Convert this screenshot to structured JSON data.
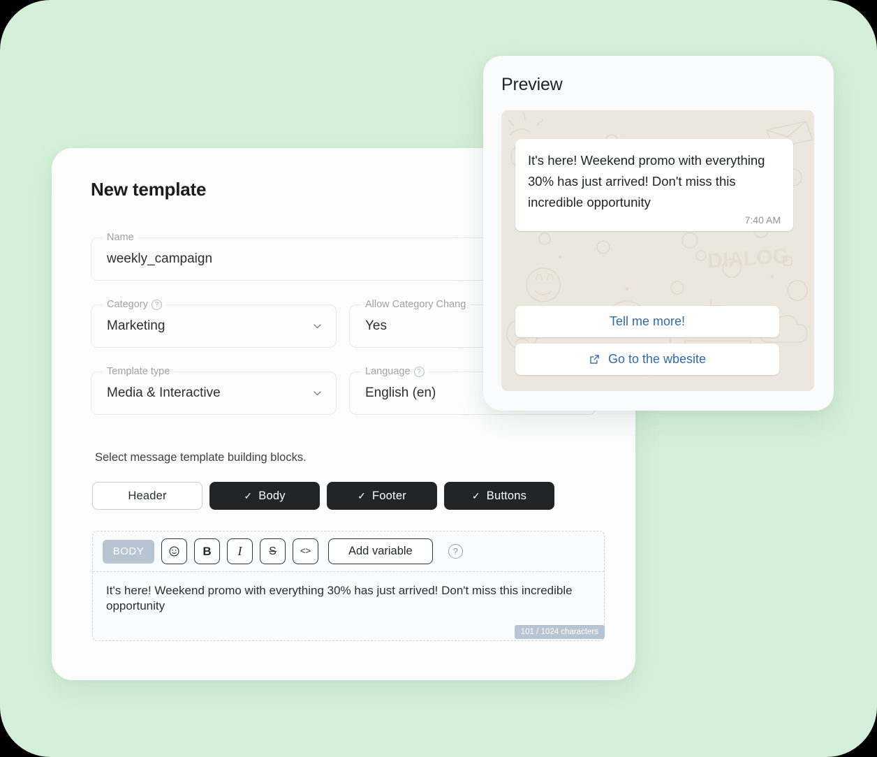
{
  "theme": {
    "background": "#d4f0d8",
    "card": "#fdfdfd",
    "accent_blue": "#2f6ab0",
    "dark_button": "#222426",
    "badge_gray": "#b9c4d2",
    "chat_background": "#ece7de"
  },
  "form": {
    "title": "New template",
    "fields": [
      {
        "label": "Name",
        "value": "weekly_campaign",
        "has_help": false,
        "has_chevron": false
      },
      {
        "label": "Category",
        "value": "Marketing",
        "has_help": true,
        "has_chevron": true
      },
      {
        "label": "Allow Category Chang",
        "value": "Yes",
        "has_help": false,
        "has_chevron": false
      },
      {
        "label": "Template type",
        "value": "Media & Interactive",
        "has_help": false,
        "has_chevron": true
      },
      {
        "label": "Language",
        "value": "English (en)",
        "has_help": true,
        "has_chevron": false
      }
    ]
  },
  "blocks": {
    "caption": "Select message template building blocks.",
    "items": [
      {
        "label": "Header",
        "selected": false,
        "check": ""
      },
      {
        "label": "Body",
        "selected": true,
        "check": "✓"
      },
      {
        "label": "Footer",
        "selected": true,
        "check": "✓"
      },
      {
        "label": "Buttons",
        "selected": true,
        "check": "✓"
      }
    ]
  },
  "editor": {
    "badge": "BODY",
    "tools": [
      {
        "name": "emoji-icon",
        "glyph": "☺"
      },
      {
        "name": "bold-icon",
        "glyph": "B"
      },
      {
        "name": "italic-icon",
        "glyph": "I"
      },
      {
        "name": "strikethrough-icon",
        "glyph": "S"
      },
      {
        "name": "code-icon",
        "glyph": "<>"
      }
    ],
    "add_variable_label": "Add variable",
    "help_glyph": "?",
    "body_text": "It's here! Weekend promo with everything 30% has just arrived! Don't miss this incredible opportunity",
    "char_counter": "101 / 1024 characters"
  },
  "preview": {
    "title": "Preview",
    "message": {
      "text": "It's here! Weekend promo with everything 30% has just arrived! Don't miss this incredible opportunity",
      "time": "7:40 AM"
    },
    "buttons": [
      {
        "label": "Tell me more!",
        "icon": ""
      },
      {
        "label": "Go to the wbesite",
        "icon": "external-link-icon"
      }
    ]
  }
}
